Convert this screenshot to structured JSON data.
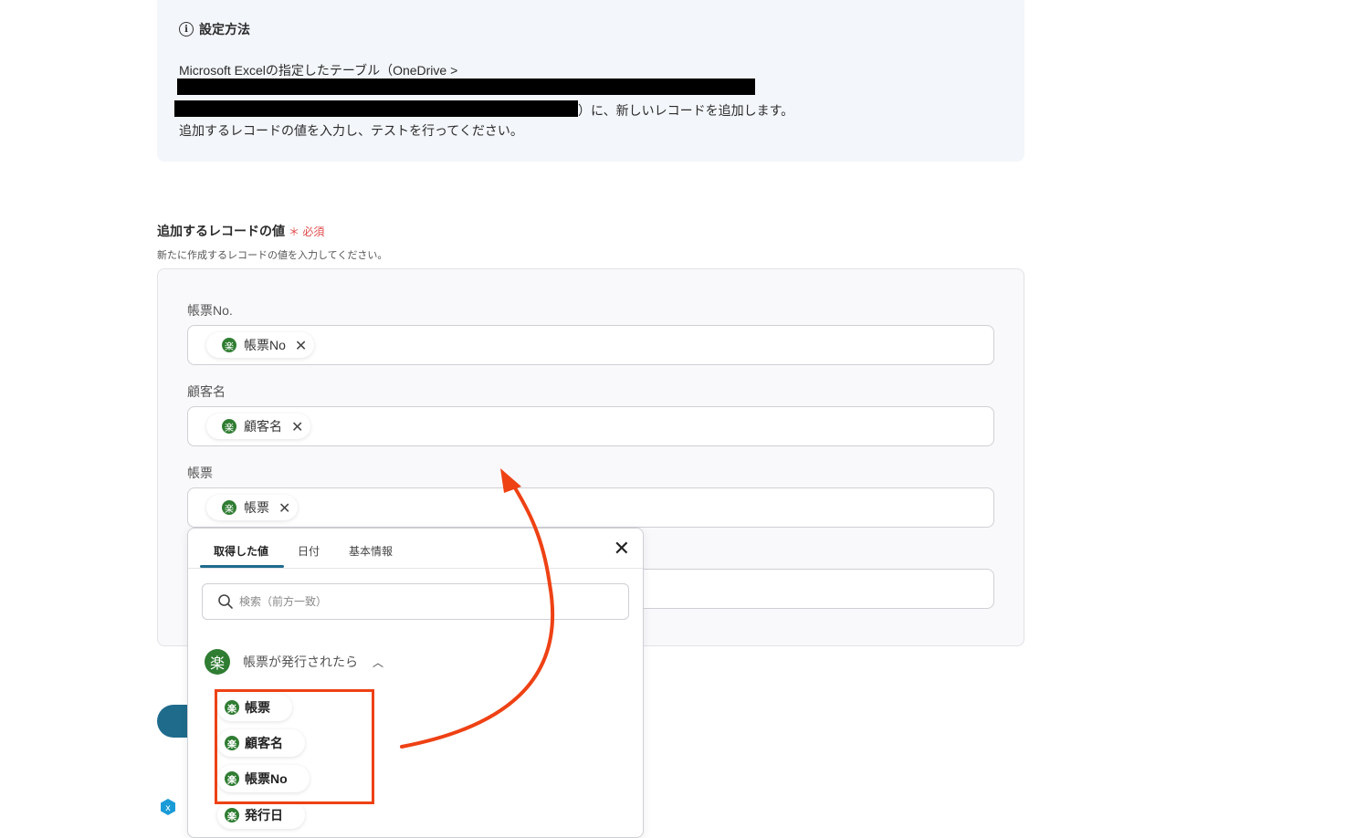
{
  "info": {
    "title": "設定方法",
    "line1": "Microsoft Excelの指定したテーブル（OneDrive >",
    "line3": "）に、新しいレコードを追加します。",
    "line4": "追加するレコードの値を入力し、テストを行ってください。"
  },
  "section": {
    "label": "追加するレコードの値",
    "required": "必須",
    "sub": "新たに作成するレコードの値を入力してください。"
  },
  "fields": [
    {
      "label": "帳票No.",
      "chip": "帳票No"
    },
    {
      "label": "顧客名",
      "chip": "顧客名"
    },
    {
      "label": "帳票",
      "chip": "帳票"
    }
  ],
  "popup": {
    "tabs": [
      "取得した値",
      "日付",
      "基本情報"
    ],
    "search_placeholder": "検索（前方一致）",
    "group": "帳票が発行されたら",
    "items": [
      "帳票",
      "顧客名",
      "帳票No",
      "発行日"
    ]
  },
  "icons": {
    "app_glyph": "楽",
    "info": "info-icon",
    "close": "close-icon",
    "search": "search-icon",
    "chevron": "chevron-up-icon"
  },
  "colors": {
    "accent": "#1f6b8c",
    "app_green": "#2f7d32",
    "highlight": "#ee4114",
    "required": "#e04a4a"
  }
}
